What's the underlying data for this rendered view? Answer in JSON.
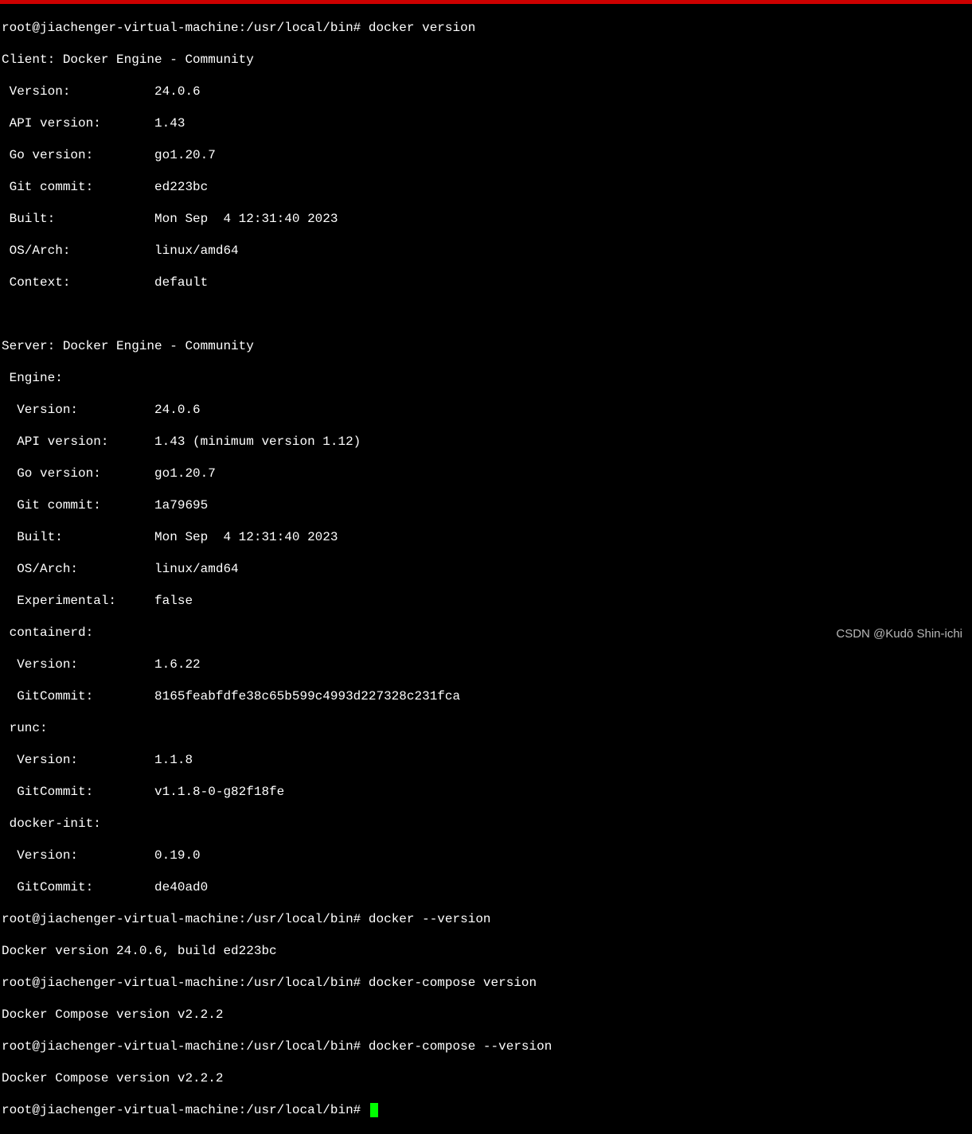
{
  "prompt": "root@jiachenger-virtual-machine:/usr/local/bin#",
  "cmd1": "docker version",
  "out_client_header": "Client: Docker Engine - Community",
  "out_client_version": " Version:           24.0.6",
  "out_client_api": " API version:       1.43",
  "out_client_go": " Go version:        go1.20.7",
  "out_client_git": " Git commit:        ed223bc",
  "out_client_built": " Built:             Mon Sep  4 12:31:40 2023",
  "out_client_os": " OS/Arch:           linux/amd64",
  "out_client_ctx": " Context:           default",
  "blank": " ",
  "out_server_header": "Server: Docker Engine - Community",
  "out_engine": " Engine:",
  "out_engine_version": "  Version:          24.0.6",
  "out_engine_api": "  API version:      1.43 (minimum version 1.12)",
  "out_engine_go": "  Go version:       go1.20.7",
  "out_engine_git": "  Git commit:       1a79695",
  "out_engine_built": "  Built:            Mon Sep  4 12:31:40 2023",
  "out_engine_os": "  OS/Arch:          linux/amd64",
  "out_engine_exp": "  Experimental:     false",
  "out_containerd": " containerd:",
  "out_containerd_version": "  Version:          1.6.22",
  "out_containerd_git": "  GitCommit:        8165feabfdfe38c65b599c4993d227328c231fca",
  "out_runc": " runc:",
  "out_runc_version": "  Version:          1.1.8",
  "out_runc_git": "  GitCommit:        v1.1.8-0-g82f18fe",
  "out_dinit": " docker-init:",
  "out_dinit_version": "  Version:          0.19.0",
  "out_dinit_git": "  GitCommit:        de40ad0",
  "cmd2": "docker --version",
  "out2": "Docker version 24.0.6, build ed223bc",
  "cmd3": "docker-compose version",
  "out3": "Docker Compose version v2.2.2",
  "cmd4": "docker-compose --version",
  "out4": "Docker Compose version v2.2.2",
  "watermark": "CSDN @Kudō Shin-ichi"
}
